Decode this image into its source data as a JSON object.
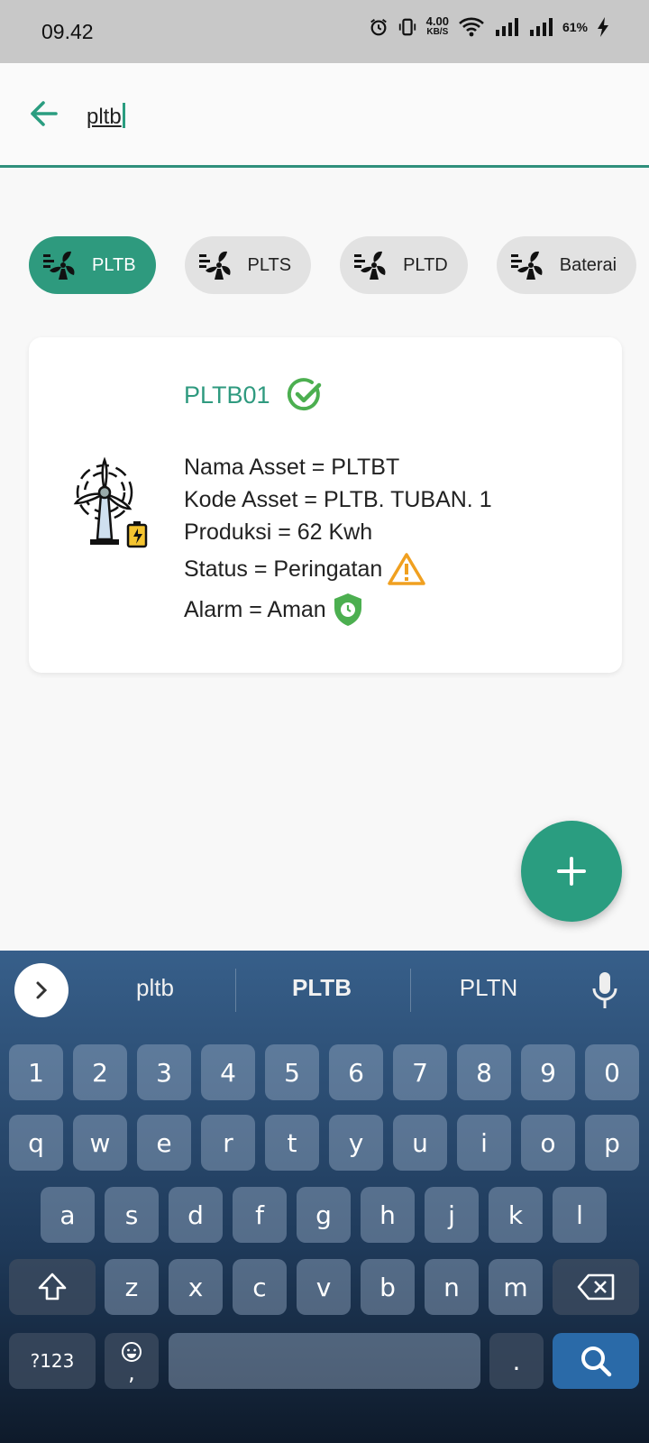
{
  "status_bar": {
    "time": "09.42",
    "net_speed": "4.00",
    "net_unit": "KB/S",
    "battery": "61%"
  },
  "search": {
    "query": "pltb"
  },
  "chips": [
    {
      "label": "PLTB",
      "active": true
    },
    {
      "label": "PLTS",
      "active": false
    },
    {
      "label": "PLTD",
      "active": false
    },
    {
      "label": "Baterai",
      "active": false
    }
  ],
  "asset_card": {
    "code": "PLTB01",
    "nama": "Nama Asset = PLTBT",
    "kode": "Kode Asset = PLTB. TUBAN. 1",
    "produksi": "Produksi = 62 Kwh",
    "status": "Status = Peringatan",
    "alarm": "Alarm = Aman"
  },
  "keyboard": {
    "suggestions": [
      "pltb",
      "PLTB",
      "PLTN"
    ],
    "row_numbers": [
      "1",
      "2",
      "3",
      "4",
      "5",
      "6",
      "7",
      "8",
      "9",
      "0"
    ],
    "row_q": [
      "q",
      "w",
      "e",
      "r",
      "t",
      "y",
      "u",
      "i",
      "o",
      "p"
    ],
    "row_a": [
      "a",
      "s",
      "d",
      "f",
      "g",
      "h",
      "j",
      "k",
      "l"
    ],
    "row_z": [
      "z",
      "x",
      "c",
      "v",
      "b",
      "n",
      "m"
    ],
    "symbols_key": "?123",
    "comma": ",",
    "period": "."
  },
  "colors": {
    "accent": "#2a9d80",
    "warning": "#f0a020",
    "ok": "#4caf50"
  }
}
